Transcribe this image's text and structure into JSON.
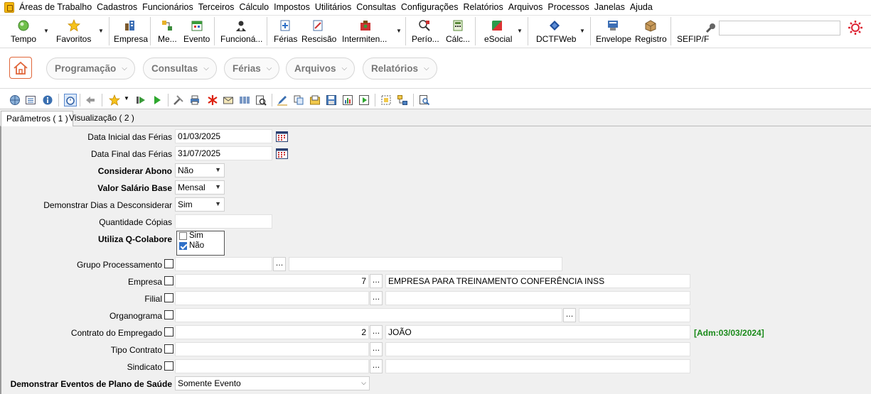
{
  "menu": [
    "Áreas de Trabalho",
    "Cadastros",
    "Funcionários",
    "Terceiros",
    "Cálculo",
    "Impostos",
    "Utilitários",
    "Consultas",
    "Configurações",
    "Relatórios",
    "Arquivos",
    "Processos",
    "Janelas",
    "Ajuda"
  ],
  "toolbar": {
    "buttons": [
      {
        "label": "Tempo",
        "icon": "tempo-icon"
      },
      {
        "label": "Favoritos",
        "icon": "star-icon"
      },
      {
        "label": "Empresa",
        "icon": "empresa-icon"
      },
      {
        "label": "Me...",
        "icon": "menu-icon"
      },
      {
        "label": "Evento",
        "icon": "evento-icon"
      },
      {
        "label": "Funcioná...",
        "icon": "funcionario-icon"
      },
      {
        "label": "Férias",
        "icon": "ferias-icon"
      },
      {
        "label": "Rescisão",
        "icon": "rescisao-icon"
      },
      {
        "label": "Intermiten...",
        "icon": "intermitente-icon"
      },
      {
        "label": "Perío...",
        "icon": "periodo-icon"
      },
      {
        "label": "Cálc...",
        "icon": "calculo-icon"
      },
      {
        "label": "eSocial",
        "icon": "esocial-icon"
      },
      {
        "label": "DCTFWeb",
        "icon": "dctfweb-icon"
      },
      {
        "label": "Envelope",
        "icon": "envelope-icon"
      },
      {
        "label": "Registro",
        "icon": "registro-icon"
      },
      {
        "label": "SEFIP/F",
        "icon": "sefip-icon"
      }
    ],
    "search_value": ""
  },
  "nav": {
    "pills": [
      {
        "label": "Programação"
      },
      {
        "label": "Consultas"
      },
      {
        "label": "Férias"
      },
      {
        "label": "Arquivos"
      },
      {
        "label": "Relatórios"
      }
    ]
  },
  "tabs": [
    {
      "label": "Parâmetros ( 1 )",
      "active": true
    },
    {
      "label": "Visualização ( 2 )",
      "active": false
    }
  ],
  "form": {
    "data_inicial": {
      "label": "Data Inicial das Férias",
      "value": "01/03/2025"
    },
    "data_final": {
      "label": "Data Final das Férias",
      "value": "31/07/2025"
    },
    "considerar_abono": {
      "label": "Considerar Abono",
      "value": "Não"
    },
    "valor_salario": {
      "label": "Valor Salário Base",
      "value": "Mensal"
    },
    "demonstrar_dias": {
      "label": "Demonstrar Dias a Desconsiderar",
      "value": "Sim"
    },
    "quantidade_copias": {
      "label": "Quantidade Cópias",
      "value": ""
    },
    "utiliza_qcolabore": {
      "label": "Utiliza Q-Colabore",
      "options": [
        {
          "label": "Sim",
          "checked": false
        },
        {
          "label": "Não",
          "checked": true
        }
      ]
    },
    "grupo_processamento": {
      "label": "Grupo Processamento",
      "code": "",
      "desc": ""
    },
    "empresa": {
      "label": "Empresa",
      "code": "7",
      "desc": "EMPRESA PARA TREINAMENTO CONFERÊNCIA INSS"
    },
    "filial": {
      "label": "Filial",
      "code": "",
      "desc": ""
    },
    "organograma": {
      "label": "Organograma",
      "code": "",
      "desc": ""
    },
    "contrato": {
      "label": "Contrato do Empregado",
      "code": "2",
      "desc": "JOÃO",
      "note": "[Adm:03/03/2024]"
    },
    "tipo_contrato": {
      "label": "Tipo Contrato",
      "code": "",
      "desc": ""
    },
    "sindicato": {
      "label": "Sindicato",
      "code": "",
      "desc": ""
    },
    "plano_saude": {
      "label": "Demonstrar Eventos de Plano de Saúde",
      "value": "Somente Evento"
    }
  }
}
